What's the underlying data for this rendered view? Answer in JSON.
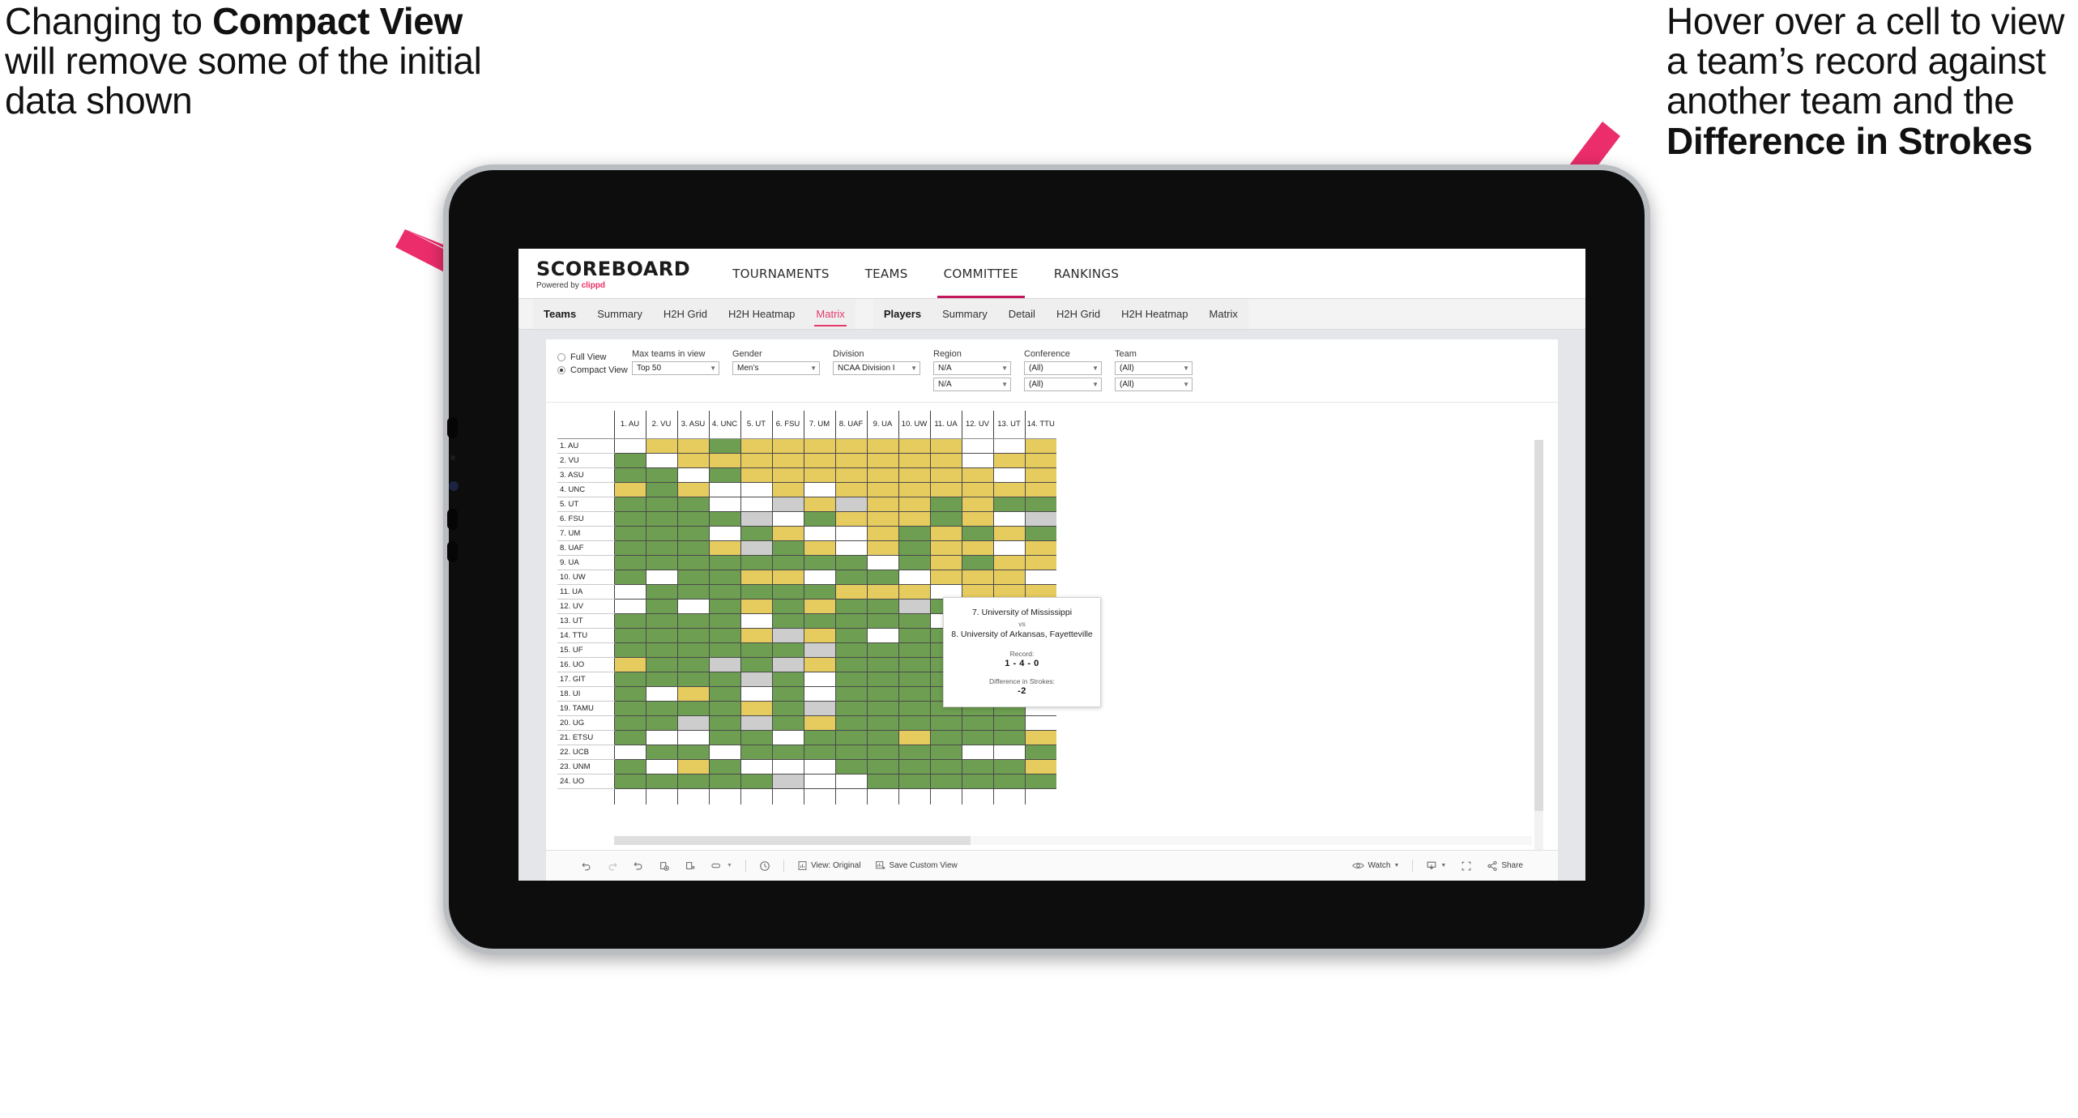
{
  "annotations": {
    "left": {
      "parts": [
        {
          "text": "Changing to ",
          "bold": false
        },
        {
          "text": "Compact View",
          "bold": true
        },
        {
          "text": " will remove some of the initial data shown",
          "bold": false
        }
      ]
    },
    "right": {
      "parts": [
        {
          "text": "Hover over a cell to view a team’s record against another team and the ",
          "bold": false
        },
        {
          "text": "Difference in Strokes",
          "bold": true
        }
      ]
    },
    "arrow_color": "#ec2d6b"
  },
  "app": {
    "brand": {
      "name": "SCOREBOARD",
      "powered_prefix": "Powered by ",
      "powered_brand": "clippd"
    },
    "topnav": [
      {
        "label": "TOURNAMENTS",
        "active": false
      },
      {
        "label": "TEAMS",
        "active": false
      },
      {
        "label": "COMMITTEE",
        "active": true
      },
      {
        "label": "RANKINGS",
        "active": false
      }
    ],
    "subtabs_teams": [
      {
        "label": "Teams",
        "head": true,
        "active": false
      },
      {
        "label": "Summary",
        "head": false,
        "active": false
      },
      {
        "label": "H2H Grid",
        "head": false,
        "active": false
      },
      {
        "label": "H2H Heatmap",
        "head": false,
        "active": false
      },
      {
        "label": "Matrix",
        "head": false,
        "active": true
      }
    ],
    "subtabs_players": [
      {
        "label": "Players",
        "head": true,
        "active": false
      },
      {
        "label": "Summary",
        "head": false,
        "active": false
      },
      {
        "label": "Detail",
        "head": false,
        "active": false
      },
      {
        "label": "H2H Grid",
        "head": false,
        "active": false
      },
      {
        "label": "H2H Heatmap",
        "head": false,
        "active": false
      },
      {
        "label": "Matrix",
        "head": false,
        "active": false
      }
    ],
    "accent": "#e5396b"
  },
  "filters": {
    "view_mode": {
      "options": [
        "Full View",
        "Compact View"
      ],
      "selected": "Compact View"
    },
    "fields": [
      {
        "label": "Max teams in view",
        "values": [
          "Top 50"
        ]
      },
      {
        "label": "Gender",
        "values": [
          "Men’s"
        ]
      },
      {
        "label": "Division",
        "values": [
          "NCAA Division I"
        ]
      },
      {
        "label": "Region",
        "values": [
          "N/A",
          "N/A"
        ]
      },
      {
        "label": "Conference",
        "values": [
          "(All)",
          "(All)"
        ]
      },
      {
        "label": "Team",
        "values": [
          "(All)",
          "(All)"
        ]
      }
    ]
  },
  "tooltip": {
    "team_a": "7. University of Mississippi",
    "vs": "vs",
    "team_b": "8. University of Arkansas, Fayetteville",
    "record_label": "Record:",
    "record_value": "1 - 4 - 0",
    "diff_label": "Difference in Strokes:",
    "diff_value": "-2"
  },
  "toolbar": {
    "items": [
      {
        "name": "undo",
        "label": ""
      },
      {
        "name": "redo",
        "label": ""
      },
      {
        "name": "revert",
        "label": ""
      },
      {
        "name": "refresh",
        "label": ""
      },
      {
        "name": "pause",
        "label": ""
      },
      {
        "name": "highlight",
        "label": ""
      },
      {
        "name": "history",
        "label": ""
      }
    ],
    "view_original": "View: Original",
    "save_custom_view": "Save Custom View",
    "watch": "Watch",
    "share": "Share"
  },
  "chart_data": {
    "type": "heatmap",
    "title": "Team Head-to-Head Matrix",
    "legend": {
      "win": "#6d9e51",
      "loss": "#e6cb5f",
      "tie": "#cdcdcd",
      "none": "#ffffff"
    },
    "columns": [
      "1. AU",
      "2. VU",
      "3. ASU",
      "4. UNC",
      "5. UT",
      "6. FSU",
      "7. UM",
      "8. UAF",
      "9. UA",
      "10. UW",
      "11. UA",
      "12. UV",
      "13. UT",
      "14. TTU"
    ],
    "rows": [
      "1. AU",
      "2. VU",
      "3. ASU",
      "4. UNC",
      "5. UT",
      "6. FSU",
      "7. UM",
      "8. UAF",
      "9. UA",
      "10. UW",
      "11. UA",
      "12. UV",
      "13. UT",
      "14. TTU",
      "15. UF",
      "16. UO",
      "17. GIT",
      "18. UI",
      "19. TAMU",
      "20. UG",
      "21. ETSU",
      "22. UCB",
      "23. UNM",
      "24. UO"
    ],
    "cells": [
      [
        "w",
        "y",
        "y",
        "g",
        "y",
        "y",
        "y",
        "y",
        "y",
        "y",
        "y",
        "w",
        "w",
        "y"
      ],
      [
        "g",
        "w",
        "y",
        "y",
        "y",
        "y",
        "y",
        "y",
        "y",
        "y",
        "y",
        "w",
        "y",
        "y"
      ],
      [
        "g",
        "g",
        "w",
        "g",
        "y",
        "y",
        "y",
        "y",
        "y",
        "y",
        "y",
        "y",
        "w",
        "y"
      ],
      [
        "y",
        "g",
        "y",
        "w",
        "w",
        "y",
        "w",
        "y",
        "y",
        "y",
        "y",
        "y",
        "y",
        "y"
      ],
      [
        "g",
        "g",
        "g",
        "w",
        "w",
        "s",
        "y",
        "s",
        "y",
        "y",
        "g",
        "y",
        "g",
        "g"
      ],
      [
        "g",
        "g",
        "g",
        "g",
        "s",
        "w",
        "g",
        "y",
        "y",
        "y",
        "g",
        "y",
        "w",
        "s"
      ],
      [
        "g",
        "g",
        "g",
        "w",
        "g",
        "y",
        "w",
        "w",
        "y",
        "g",
        "y",
        "g",
        "y",
        "g"
      ],
      [
        "g",
        "g",
        "g",
        "y",
        "s",
        "g",
        "y",
        "w",
        "y",
        "g",
        "y",
        "y",
        "w",
        "y"
      ],
      [
        "g",
        "g",
        "g",
        "g",
        "g",
        "g",
        "g",
        "g",
        "w",
        "g",
        "y",
        "g",
        "y",
        "y"
      ],
      [
        "g",
        "w",
        "g",
        "g",
        "y",
        "y",
        "w",
        "g",
        "g",
        "w",
        "y",
        "y",
        "y",
        "w"
      ],
      [
        "w",
        "g",
        "g",
        "g",
        "g",
        "g",
        "g",
        "y",
        "y",
        "y",
        "w",
        "y",
        "y",
        "y"
      ],
      [
        "w",
        "g",
        "w",
        "g",
        "y",
        "g",
        "y",
        "g",
        "g",
        "s",
        "g",
        "w",
        "g",
        "w"
      ],
      [
        "g",
        "g",
        "g",
        "g",
        "w",
        "g",
        "g",
        "g",
        "g",
        "g",
        "w",
        "g",
        "w",
        "y"
      ],
      [
        "g",
        "g",
        "g",
        "g",
        "y",
        "s",
        "y",
        "g",
        "w",
        "g",
        "g",
        "y",
        "y",
        "s"
      ],
      [
        "g",
        "g",
        "g",
        "g",
        "g",
        "g",
        "s",
        "g",
        "g",
        "g",
        "g",
        "w",
        "g",
        "y"
      ],
      [
        "y",
        "g",
        "g",
        "s",
        "g",
        "s",
        "y",
        "g",
        "g",
        "g",
        "g",
        "g",
        "y",
        "y"
      ],
      [
        "g",
        "g",
        "g",
        "g",
        "s",
        "g",
        "w",
        "g",
        "g",
        "g",
        "g",
        "g",
        "g",
        "w"
      ],
      [
        "g",
        "w",
        "y",
        "g",
        "w",
        "g",
        "w",
        "g",
        "g",
        "g",
        "g",
        "w",
        "g",
        "y"
      ],
      [
        "g",
        "g",
        "g",
        "g",
        "y",
        "g",
        "s",
        "g",
        "g",
        "g",
        "g",
        "g",
        "g",
        "w"
      ],
      [
        "g",
        "g",
        "s",
        "g",
        "s",
        "g",
        "y",
        "g",
        "g",
        "g",
        "g",
        "g",
        "g",
        "w"
      ],
      [
        "g",
        "w",
        "w",
        "g",
        "g",
        "w",
        "g",
        "g",
        "g",
        "y",
        "g",
        "g",
        "g",
        "y"
      ],
      [
        "w",
        "g",
        "g",
        "w",
        "g",
        "g",
        "g",
        "g",
        "g",
        "g",
        "g",
        "w",
        "w",
        "g"
      ],
      [
        "g",
        "w",
        "y",
        "g",
        "w",
        "w",
        "w",
        "g",
        "g",
        "g",
        "g",
        "g",
        "g",
        "y"
      ],
      [
        "g",
        "g",
        "g",
        "g",
        "g",
        "s",
        "w",
        "w",
        "g",
        "g",
        "g",
        "g",
        "g",
        "g"
      ]
    ]
  }
}
